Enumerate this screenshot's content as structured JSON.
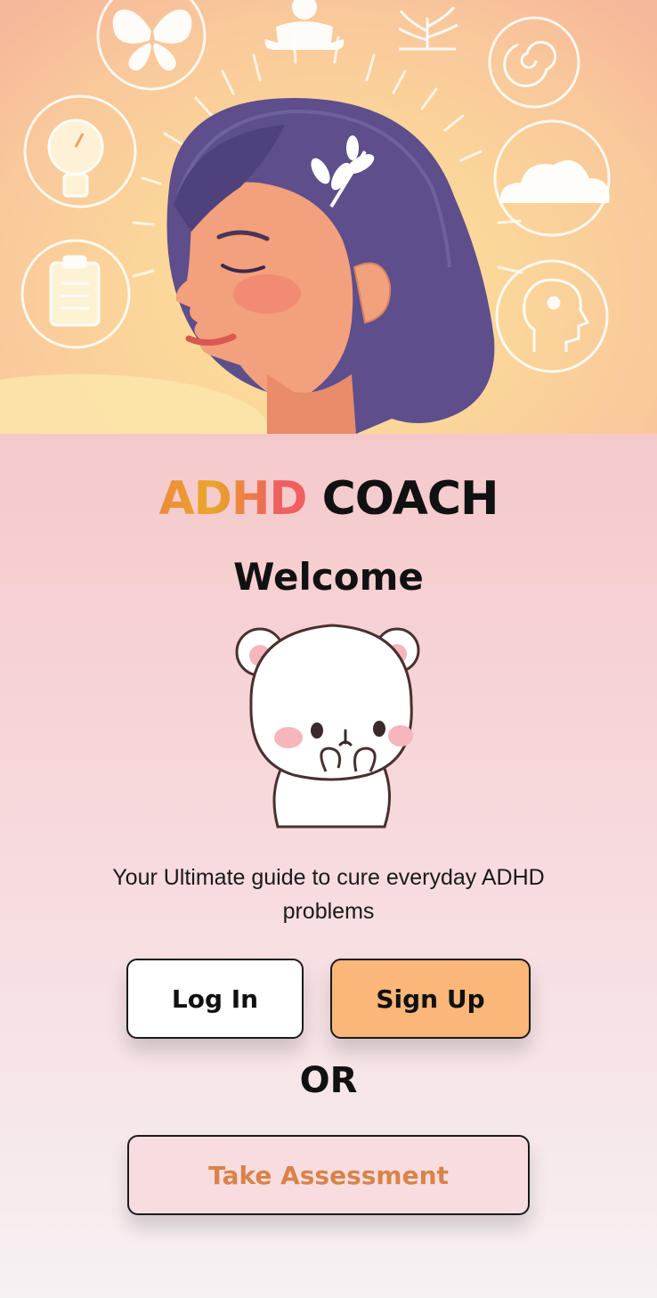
{
  "header": {
    "hero_image": "woman-meditating-illustration",
    "brand_part": "ADHD",
    "title_part": "COACH"
  },
  "welcome": {
    "heading": "Welcome",
    "mascot": "white-bear-sticker",
    "tagline": "Your Ultimate guide to cure everyday ADHD problems"
  },
  "actions": {
    "login_label": "Log In",
    "signup_label": "Sign Up",
    "separator": "OR",
    "assessment_label": "Take Assessment"
  },
  "colors": {
    "brand_gradient_start": "#ec8a3a",
    "brand_gradient_end": "#ef5f5f",
    "signup_bg": "#fbb679",
    "assessment_text": "#d98349",
    "assessment_bg": "#f8dde0",
    "page_bg": "#f5c9cb"
  }
}
